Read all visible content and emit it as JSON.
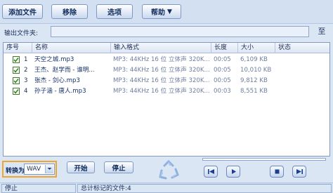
{
  "toolbar": {
    "add_label": "添加文件",
    "remove_label": "移除",
    "options_label": "选项",
    "help_label": "帮助"
  },
  "output": {
    "label": "输出文件夹:",
    "value": "",
    "browse_label": "至"
  },
  "list": {
    "columns": [
      "序号",
      "名称",
      "输入格式",
      "长度",
      "大小",
      "状态"
    ],
    "rows": [
      {
        "index": "1",
        "checked": true,
        "name": "天空之城.mp3",
        "format": "MP3: 44KHz 16 位 立体声 320K...",
        "length": "00:05",
        "size": "6,109 KB",
        "status": ""
      },
      {
        "index": "2",
        "checked": true,
        "name": "王杰、赵学而 - 谁明...",
        "format": "MP3: 44KHz 16 位 立体声 320K...",
        "length": "00:05",
        "size": "10,010 KB",
        "status": ""
      },
      {
        "index": "3",
        "checked": true,
        "name": "张杰 - 剑心.mp3",
        "format": "MP3: 44KHz 16 位 立体声 320K...",
        "length": "00:05",
        "size": "9,812 KB",
        "status": ""
      },
      {
        "index": "4",
        "checked": true,
        "name": "孙子涵 - 唐人.mp3",
        "format": "MP3: 44KHz 16 位 立体声 320K...",
        "length": "00:03",
        "size": "8,551 KB",
        "status": ""
      }
    ]
  },
  "convert": {
    "label": "转换为",
    "format": "WAV"
  },
  "actions": {
    "start_label": "开始",
    "stop_label": "停止"
  },
  "player": {
    "progress": 0.0,
    "buttons": [
      "previous-icon",
      "play-icon",
      "stop-icon",
      "next-icon"
    ]
  },
  "status": {
    "state": "停止",
    "total": "总计标记的文件:4"
  },
  "colors": {
    "accent": "#f0a52c",
    "check": "#2f8a1e",
    "blue": "#1b3f8c"
  }
}
